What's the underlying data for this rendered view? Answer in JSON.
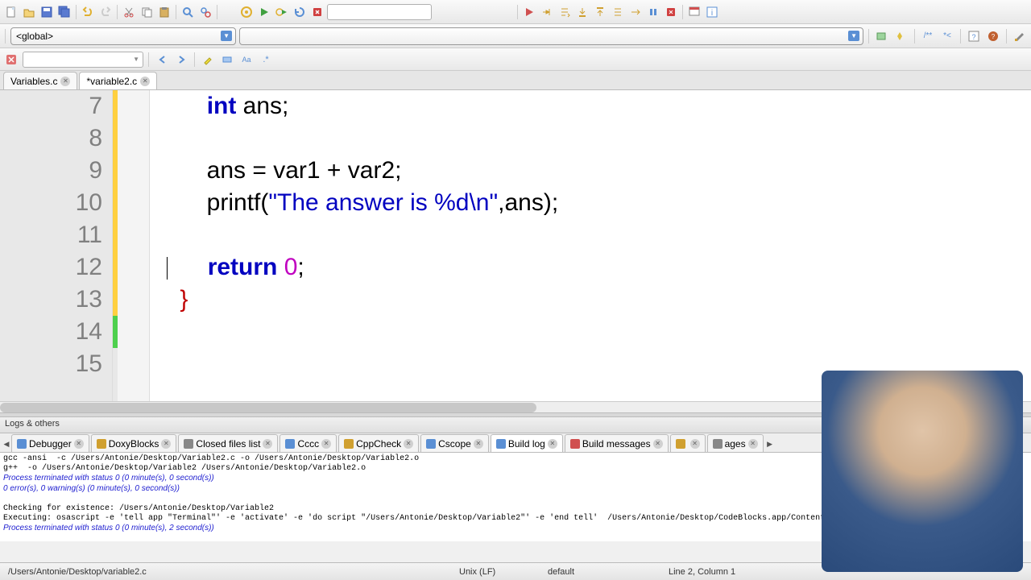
{
  "toolbar1": {
    "build_combo": ""
  },
  "scope": {
    "value": "<global>"
  },
  "tabs": [
    {
      "label": "Variables.c",
      "active": false
    },
    {
      "label": "*variable2.c",
      "active": true
    }
  ],
  "code_lines": [
    {
      "n": 7,
      "indent": "        ",
      "tokens": [
        [
          "kw",
          "int"
        ],
        [
          "",
          " ans;"
        ]
      ]
    },
    {
      "n": 8,
      "indent": "",
      "tokens": []
    },
    {
      "n": 9,
      "indent": "        ",
      "tokens": [
        [
          "",
          "ans = var1 + var2;"
        ]
      ]
    },
    {
      "n": 10,
      "indent": "        ",
      "tokens": [
        [
          "",
          "printf("
        ],
        [
          "str",
          "\"The answer is %d\\n\""
        ],
        [
          "",
          ",ans);"
        ]
      ]
    },
    {
      "n": 11,
      "indent": "",
      "tokens": []
    },
    {
      "n": 12,
      "indent": "        ",
      "tokens": [
        [
          "kw",
          "return"
        ],
        [
          "",
          " "
        ],
        [
          "num",
          "0"
        ],
        [
          "",
          ";"
        ]
      ]
    },
    {
      "n": 13,
      "indent": "    ",
      "tokens": [
        [
          "brace",
          "}"
        ]
      ]
    },
    {
      "n": 14,
      "indent": "",
      "tokens": []
    },
    {
      "n": 15,
      "indent": "",
      "tokens": []
    }
  ],
  "change_markers": [
    "cy",
    "cy",
    "cy",
    "cy",
    "cy",
    "cy",
    "cy",
    "cg",
    ""
  ],
  "logs_title": "Logs & others",
  "log_tabs": [
    "Debugger",
    "DoxyBlocks",
    "Closed files list",
    "Cccc",
    "CppCheck",
    "Cscope",
    "Build log",
    "Build messages",
    "",
    "ages"
  ],
  "log_active": 6,
  "build_log": {
    "l1": "gcc -ansi  -c /Users/Antonie/Desktop/Variable2.c -o /Users/Antonie/Desktop/Variable2.o",
    "l2": "g++  -o /Users/Antonie/Desktop/Variable2 /Users/Antonie/Desktop/Variable2.o",
    "l3": "Process terminated with status 0 (0 minute(s), 0 second(s))",
    "l4": "0 error(s), 0 warning(s) (0 minute(s), 0 second(s))",
    "l5": "",
    "l6": "Checking for existence: /Users/Antonie/Desktop/Variable2",
    "l7": "Executing: osascript -e 'tell app \"Terminal\"' -e 'activate' -e 'do script \"/Users/Antonie/Desktop/Variable2\"' -e 'end tell'  /Users/Antonie/Desktop/CodeBlocks.app/Contents/MacOS/cb_console_runner  (in /Users/An",
    "l8": "Process terminated with status 0 (0 minute(s), 2 second(s))"
  },
  "status": {
    "path": "/Users/Antonie/Desktop/variable2.c",
    "enc": "Unix (LF)",
    "mode": "default",
    "pos": "Line 2, Column 1"
  }
}
